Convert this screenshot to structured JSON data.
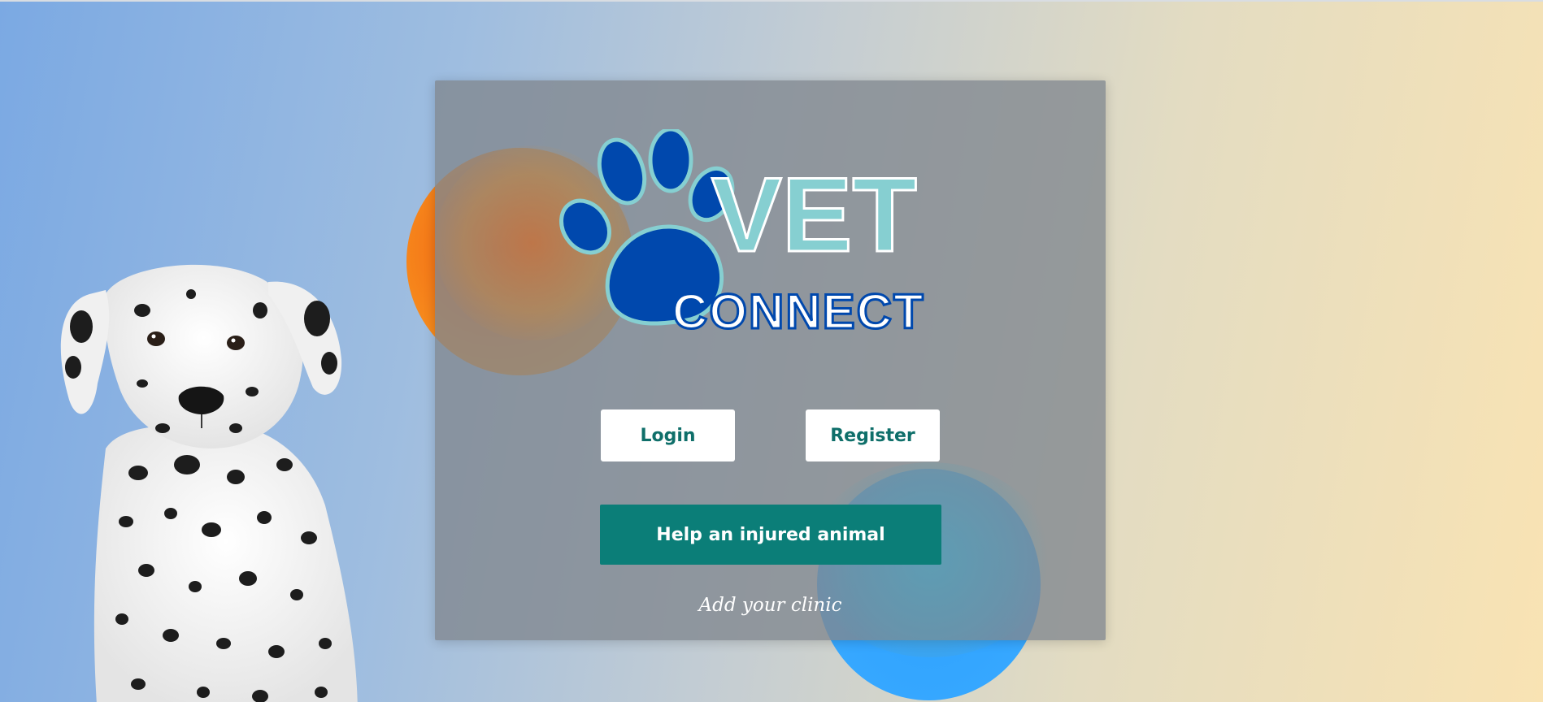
{
  "brand": {
    "logo_word_top": "VET",
    "logo_word_bottom": "CONNECT",
    "primary_color": "#0b7e78",
    "paw_color": "#0048ad",
    "logo_teal": "#86cfd1"
  },
  "buttons": {
    "login_label": "Login",
    "register_label": "Register",
    "help_label": "Help an injured animal"
  },
  "links": {
    "add_clinic_label": "Add your clinic"
  },
  "icons": {
    "logo": "paw-icon",
    "illustration": "dalmatian-puppy"
  }
}
